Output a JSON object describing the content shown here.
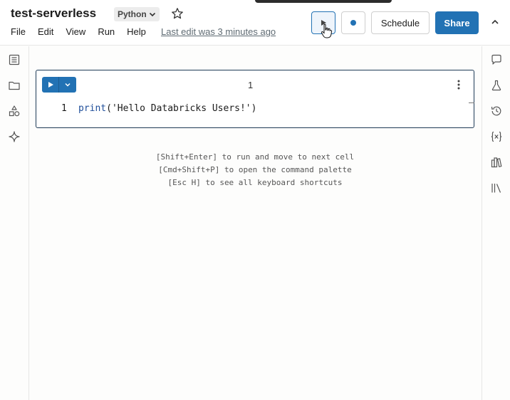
{
  "header": {
    "notebook_title": "test-serverless",
    "language": "Python",
    "menu": [
      "File",
      "Edit",
      "View",
      "Run",
      "Help"
    ],
    "last_edit": "Last edit was 3 minutes ago",
    "schedule_label": "Schedule",
    "share_label": "Share"
  },
  "left_rail": {
    "icons": [
      "table-of-contents-icon",
      "folder-icon",
      "shapes-icon",
      "sparkle-icon"
    ]
  },
  "right_rail": {
    "icons": [
      "comment-icon",
      "flask-icon",
      "history-icon",
      "variables-icon",
      "library-icon",
      "bookshelf-icon"
    ]
  },
  "cell": {
    "number": "1",
    "line_number": "1",
    "code_fn": "print",
    "code_open": "(",
    "code_string": "'Hello Databricks Users!'",
    "code_close": ")"
  },
  "hints": [
    "[Shift+Enter] to run and move to next cell",
    "[Cmd+Shift+P] to open the command palette",
    "[Esc H] to see all keyboard shortcuts"
  ],
  "colors": {
    "accent": "#2272b4",
    "cell_border": "#1f3b57",
    "background": "#fdfdfc"
  }
}
